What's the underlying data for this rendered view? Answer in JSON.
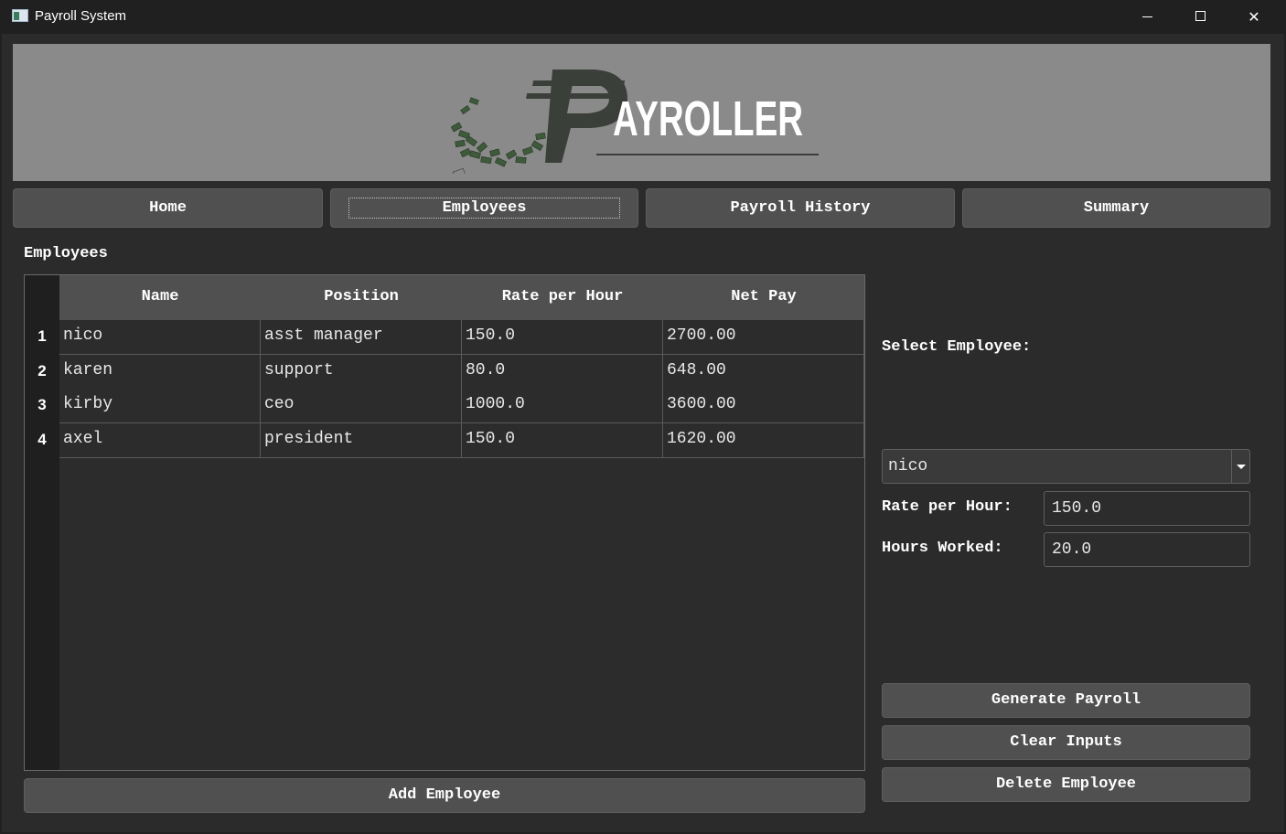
{
  "window": {
    "title": "Payroll System",
    "icon": "app-window-icon",
    "controls": [
      "minimize-icon",
      "maximize-icon",
      "close-icon"
    ]
  },
  "banner": {
    "logo_text": "AYROLLER",
    "logo_glyph": "₱"
  },
  "nav": {
    "home": "Home",
    "employees": "Employees",
    "payroll_history": "Payroll History",
    "summary": "Summary",
    "active": "employees"
  },
  "main": {
    "section_title": "Employees",
    "table": {
      "columns": [
        "Name",
        "Position",
        "Rate per Hour",
        "Net Pay"
      ],
      "rows": [
        {
          "num": "1",
          "name": "nico",
          "position": "asst manager",
          "rate": "150.0",
          "net_pay": "2700.00"
        },
        {
          "num": "2",
          "name": "karen",
          "position": "support",
          "rate": "80.0",
          "net_pay": "648.00"
        },
        {
          "num": "3",
          "name": "kirby",
          "position": "ceo",
          "rate": "1000.0",
          "net_pay": "3600.00"
        },
        {
          "num": "4",
          "name": "axel",
          "position": "president",
          "rate": "150.0",
          "net_pay": "1620.00"
        }
      ]
    },
    "add_button": "Add Employee"
  },
  "side": {
    "select_label": "Select Employee:",
    "selected_employee": "nico",
    "rate_label": "Rate per Hour:",
    "rate_value": "150.0",
    "hours_label": "Hours Worked:",
    "hours_value": "20.0",
    "generate_button": "Generate Payroll",
    "clear_button": "Clear Inputs",
    "delete_button": "Delete Employee"
  },
  "colors": {
    "background": "#2b2b2b",
    "button": "#505050",
    "banner": "#8a8a8a",
    "text": "#ffffff"
  }
}
